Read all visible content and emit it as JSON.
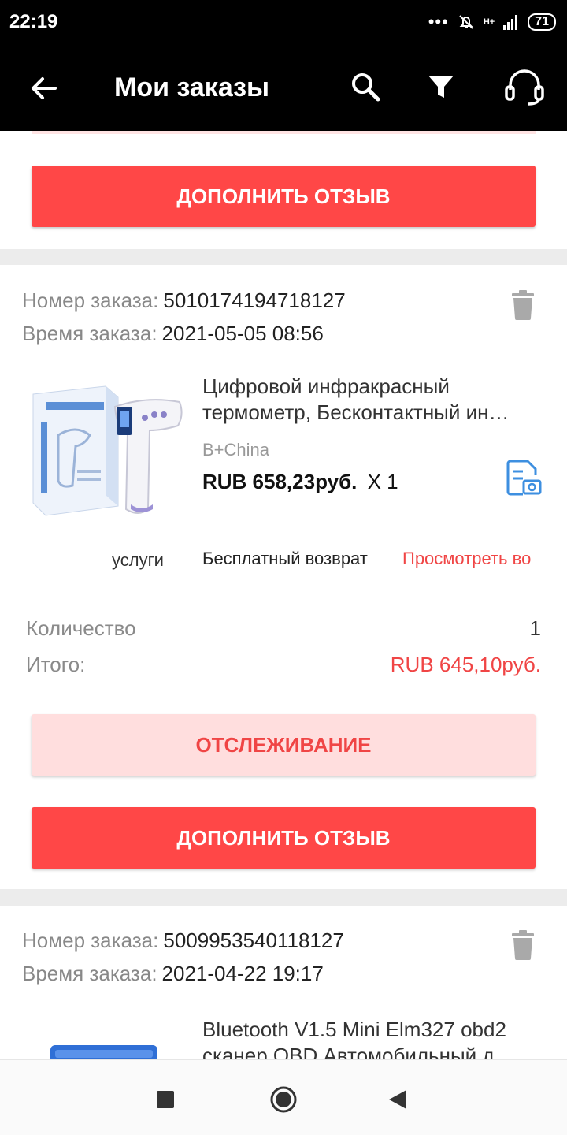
{
  "status_bar": {
    "time": "22:19",
    "signal_label": "H+",
    "battery": "71"
  },
  "app_bar": {
    "title": "Мои заказы"
  },
  "orders": [
    {
      "review_label": "ДОПОЛНИТЬ ОТЗЫВ"
    },
    {
      "order_number_label": "Номер заказа:",
      "order_number": "5010174194718127",
      "order_time_label": "Время заказа:",
      "order_time": "2021-05-05 08:56",
      "product": {
        "name_line1": "Цифровой инфракрасный",
        "name_line2": "термометр, Бесконтактный ин…",
        "seller": "B+China",
        "price": "RUB 658,23руб.",
        "quantity": "X 1"
      },
      "services_label": "услуги",
      "free_return_label": "Бесплатный возврат",
      "view_label": "Просмотреть во",
      "quantity_label": "Количество",
      "quantity_value": "1",
      "total_label": "Итого:",
      "total_value": "RUB 645,10руб.",
      "tracking_label": "ОТСЛЕЖИВАНИЕ",
      "review_label": "ДОПОЛНИТЬ ОТЗЫВ"
    },
    {
      "order_number_label": "Номер заказа:",
      "order_number": "5009953540118127",
      "order_time_label": "Время заказа:",
      "order_time": "2021-04-22 19:17",
      "product": {
        "name_line1": "Bluetooth V1.5 Mini Elm327 obd2",
        "name_line2": "сканер OBD Автомобильный д"
      }
    }
  ],
  "colors": {
    "accent": "#ff4747",
    "accent_soft": "#ffdede",
    "price_red": "#f04545",
    "link_blue": "#3d8fe0"
  },
  "icons": [
    "back-arrow-icon",
    "search-icon",
    "filter-icon",
    "headset-icon",
    "trash-icon",
    "photo-review-icon",
    "nav-recents-icon",
    "nav-home-icon",
    "nav-back-icon"
  ]
}
